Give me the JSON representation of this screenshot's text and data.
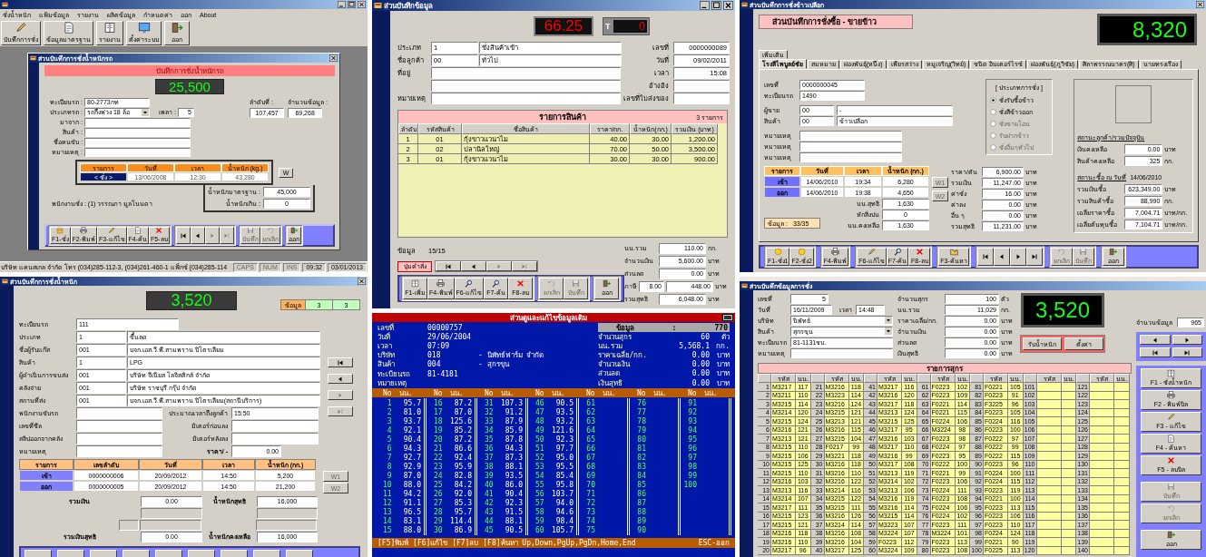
{
  "scale_window": {
    "menu": [
      "ชั่งน้ำหนัก",
      "แฟ้มข้อมูล",
      "รายงาน",
      "ผลิตข้อมูล",
      "กำหนดค่า",
      "ออก",
      "About"
    ],
    "toolbar": [
      "บันทึกการชั่ง",
      "ข้อมูลมาตรฐาน",
      "รายงาน",
      "ตั้งค่าระบบ",
      "ออก"
    ],
    "child_title": "ส่วนบันทึกการชั่งน้ำหนักรถ",
    "header": "บันทึกการชั่งน้ำหนักรถ",
    "display": "25,500",
    "fields": [
      {
        "label": "ทะเบียนรถ :",
        "value": "80-2773กท",
        "kind": "text"
      },
      {
        "label": "ประเภทรถ :",
        "value": "รถกึ่งพ่วง 18 ล้อ",
        "kind": "dropdown"
      },
      {
        "label": "มาจาก :",
        "kind": "text"
      },
      {
        "label": "สินค้า :",
        "kind": "text"
      },
      {
        "label": "ชื่อคนขับ :",
        "kind": "text"
      },
      {
        "label": "หมายเหตุ :",
        "kind": "text"
      }
    ],
    "axle": {
      "label": "เพลา :",
      "value": "5"
    },
    "counters": [
      {
        "label": "ลำดับที่ :",
        "value": "107,457"
      },
      {
        "label": "จำนวนข้อมูล :",
        "value": "69,268"
      }
    ],
    "table": {
      "columns": [
        "รายการ",
        "วันที่",
        "เวลา",
        "น้ำหนัก (kg.)"
      ],
      "row": [
        "< ชั่ง >",
        "13/06/2008",
        "12:30",
        "43,280"
      ]
    },
    "w_button": "W",
    "limits": [
      {
        "label": "น้ำหนักมาตรฐาน :",
        "value": "45,000"
      },
      {
        "label": "น้ำหนักเกิน :",
        "value": "0"
      }
    ],
    "operator": "พนักงานชั่ง : (1) วรรณภา มูลโนนดา",
    "buttons": [
      {
        "label": "F1-ชั่ง",
        "disabled": false
      },
      {
        "label": "F2-พิมพ์",
        "disabled": false
      },
      {
        "label": "F3-แก้ไข",
        "disabled": false
      },
      {
        "label": "F4-ค้น",
        "disabled": false
      },
      {
        "label": "F5-ลบ",
        "disabled": false
      }
    ],
    "nav": [
      {
        "disabled": false
      },
      {
        "disabled": false
      },
      {
        "disabled": true
      },
      {
        "disabled": true
      }
    ],
    "actions": [
      {
        "label": "บันทึก",
        "disabled": true
      },
      {
        "label": "ยกเลิก",
        "disabled": true
      },
      {
        "label": "ออก",
        "disabled": false
      }
    ],
    "status_bar": {
      "company": "บริษัท แคนสเกล จำกัด  โทร (034)285-112-3, (034)261-460-1  แฟ็กซ์ (034)285-114",
      "cells": [
        {
          "text": "CAPS",
          "on": false
        },
        {
          "text": "NUM",
          "on": false
        },
        {
          "text": "INS",
          "on": false
        },
        {
          "text": "09:32",
          "on": true
        },
        {
          "text": "03/01/2013",
          "on": true
        }
      ]
    }
  },
  "invoice_window": {
    "title": "ส่วนบันทึกข้อมูล",
    "display": "66.25",
    "tare": {
      "label": "T",
      "value": "0"
    },
    "left_fields": [
      {
        "label": "ประเภท",
        "code": "1",
        "value": "ชั่งสินค้าเข้า",
        "kind": "coded"
      },
      {
        "label": "ชื่อลูกค้า",
        "code": "00",
        "value": "ทั่วไป",
        "kind": "coded"
      },
      {
        "label": "ที่อยู่",
        "kind": "wide"
      },
      {
        "kind": "wide"
      },
      {
        "label": "หมายเหตุ",
        "kind": "wide"
      }
    ],
    "right_fields": [
      {
        "label": "เลขที่",
        "value": "0000000089"
      },
      {
        "label": "วันที่",
        "value": "09/02/2011"
      },
      {
        "label": "เวลา",
        "value": "15:08"
      },
      {
        "label": "อ้างอิง"
      },
      {
        "label": "เลขที่ใบส่งของ"
      }
    ],
    "table": {
      "title": "รายการสินค้า",
      "count": "3  รายการ",
      "columns": [
        "ลำดับ",
        "รหัสสินค้า",
        "ชื่อสินค้า",
        "ราคา/กก.",
        "น้ำหนัก(กก.)",
        "รวมเงิน (บาท)"
      ],
      "rows": [
        [
          "1",
          "01",
          "กุ้งขาวแวนาไม",
          "40.00",
          "30.00",
          "1,200.00"
        ],
        [
          "2",
          "02",
          "ปลานิลใหญ่",
          "70.00",
          "50.00",
          "3,500.00"
        ],
        [
          "3",
          "01",
          "กุ้งขาวแวนาไม",
          "30.00",
          "30.00",
          "900.00"
        ]
      ]
    },
    "record": {
      "label": "ข้อมูล",
      "value": "15/15"
    },
    "command_button": "ปุ่มคำสั่ง",
    "nav": [
      {
        "disabled": false
      },
      {
        "disabled": false
      },
      {
        "disabled": true
      },
      {
        "disabled": true
      }
    ],
    "buttons": [
      {
        "label": "F1-เพิ่ม",
        "disabled": false
      },
      {
        "label": "F4-พิมพ์",
        "disabled": false
      },
      {
        "label": "F6-แก้ไข",
        "disabled": false
      },
      {
        "label": "F7-ค้น",
        "disabled": false
      },
      {
        "label": "F8-ลบ",
        "disabled": false
      }
    ],
    "actions": [
      {
        "label": "ยกเลิก",
        "disabled": true
      },
      {
        "label": "บันทึก",
        "disabled": true
      },
      {
        "label": "ออก",
        "disabled": false
      }
    ],
    "totals": [
      {
        "label": "นน.รวม",
        "value": "110.00",
        "unit": "กก."
      },
      {
        "label": "จำนวนเงิน",
        "value": "5,600.00",
        "unit": "บาท"
      },
      {
        "label": "ส่วนลด",
        "value": "0.00",
        "unit": "บาท"
      },
      {
        "label": "ภาษี",
        "rate": "8.00",
        "value": "448.00",
        "unit": "บาท"
      },
      {
        "label": "รวมสุทธิ",
        "value": "6,048.00",
        "unit": "บาท"
      }
    ]
  },
  "rice_window": {
    "title": "ส่วนบันทึกการชั่งข้าวเปลือก",
    "header": "ส่วนบันทึกการชั่งซื้อ - ขายข้าว",
    "display": "8,320",
    "tabs_top": [
      {
        "label": "เพิ่มเติม",
        "selected": false
      }
    ],
    "tabs": [
      {
        "label": "โรงสีไพบูลย์ชัย",
        "selected": true
      },
      {
        "label": "สมหมาย",
        "selected": false
      },
      {
        "label": "ผ่องพันธุ์(หนึ่ง)",
        "selected": false
      },
      {
        "label": "เพียรสว่าง",
        "selected": false
      },
      {
        "label": "หมูเจริญ(วิทย์)",
        "selected": false
      },
      {
        "label": "ชนิด อินเตอร์ไรซ์",
        "selected": false
      },
      {
        "label": "ผ่องพันธุ์(ภูวิชัย)",
        "selected": false
      },
      {
        "label": "ศิลาพรรณนาคร(ศิ)",
        "selected": false
      },
      {
        "label": "นายทรงเรือง",
        "selected": false
      }
    ],
    "fields": [
      {
        "label": "เลขที่",
        "value": "0000000045",
        "kind": "single"
      },
      {
        "label": "ทะเบียนรถ",
        "value": "1490",
        "kind": "single"
      },
      {
        "label": "ผู้ขาย",
        "code": "00",
        "value": "-",
        "kind": "coded"
      },
      {
        "label": "สินค้า",
        "code": "00",
        "value": "ข้าวเปลือก",
        "kind": "coded"
      },
      {
        "label": "หมายเหตุ",
        "kind": "note"
      },
      {
        "label": "หมายเหตุ",
        "kind": "note"
      },
      {
        "label": "หมายเหตุ",
        "kind": "note"
      }
    ],
    "type_group": {
      "title": "[ ประเภทการชั่ง ]",
      "options": [
        {
          "label": "ชั่งรับซื้อข้าว",
          "selected": true,
          "disabled": false
        },
        {
          "label": "ชั่งสีข้าวออก",
          "selected": false,
          "disabled": false
        },
        {
          "label": "ชั่งขายโอน",
          "selected": false,
          "disabled": true
        },
        {
          "label": "รับฝากข้าว",
          "selected": false,
          "disabled": true
        },
        {
          "label": "ชั่งอื่นๆทั่วไป",
          "selected": false,
          "disabled": true
        }
      ]
    },
    "table": {
      "columns": [
        "รายการ",
        "วันที่",
        "เวลา",
        "น้ำหนัก (กก.)"
      ],
      "rows": [
        [
          "เข้า",
          "14/06/2010",
          "19:34",
          "6,280"
        ],
        [
          "ออก",
          "14/06/2010",
          "19:38",
          "4,650"
        ]
      ]
    },
    "w_buttons": [
      {
        "label": "W1",
        "disabled": true
      },
      {
        "label": "W2",
        "disabled": true
      }
    ],
    "weights": [
      {
        "label": "นน.สุทธิ",
        "value": "1,630"
      },
      {
        "label": "หักสิ่งปน",
        "value": "0"
      },
      {
        "label": "นน.คงเหลือ",
        "value": "1,630"
      }
    ],
    "record": {
      "label": "ข้อมูล :",
      "value": "33/35"
    },
    "money": [
      {
        "label": "ราคา/ตัน",
        "value": "6,900.00",
        "unit": "บาท"
      },
      {
        "label": "รวมเงิน",
        "value": "11,247.00",
        "unit": "บาท"
      },
      {
        "label": "ค่าชั่ง",
        "value": "16.00",
        "unit": "บาท"
      },
      {
        "label": "ค่าลง",
        "value": "0.00",
        "unit": "บาท"
      },
      {
        "label": "อื่น ๆ",
        "value": "0.00",
        "unit": "บาท"
      },
      {
        "label": "รวมสุทธิ",
        "value": "11,231.00",
        "unit": "บาท"
      }
    ],
    "customer_status": {
      "title": "สถานะลูกค้า/รวมปัจจุบัน",
      "rows": [
        {
          "label": "เงินคงเหลือ",
          "value": "0.00",
          "unit": "บาท"
        },
        {
          "label": "สินค้าคงเหลือ",
          "value": "325",
          "unit": "กก."
        }
      ]
    },
    "purchase_status": {
      "title": "สถานะซื้อ ณ วันที่",
      "date": "14/06/2010",
      "rows": [
        {
          "label": "รวมเงินซื้อ",
          "value": "623,349.00",
          "unit": "บาท"
        },
        {
          "label": "รวมสินค้าซื้อ",
          "value": "88,990",
          "unit": "กก."
        },
        {
          "label": "เฉลี่ยราคาซื้อ",
          "value": "7,004.71",
          "unit": "บาท/กก."
        },
        {
          "label": "เฉลี่ยต้นทุนซื้อ",
          "value": "7,104.71",
          "unit": "บาท/กก."
        }
      ]
    },
    "buttons": [
      {
        "label": "F1-ชั่ง1",
        "disabled": false
      },
      {
        "label": "F2-ชั่ง2",
        "disabled": false
      },
      {
        "label": "F4-พิมพ์",
        "disabled": false
      },
      {
        "label": "F6-แก้ไข",
        "disabled": false
      },
      {
        "label": "F7-ค้น",
        "disabled": false
      },
      {
        "label": "F8-ลบ",
        "disabled": false
      },
      {
        "label": "F3-ค้นหา",
        "disabled": false
      }
    ],
    "nav": [
      {
        "disabled": false
      },
      {
        "disabled": false
      },
      {
        "disabled": false
      },
      {
        "disabled": false
      }
    ],
    "actions": [
      {
        "label": "ยกเลิก",
        "disabled": true
      },
      {
        "label": "บันทึก",
        "disabled": true
      },
      {
        "label": "ออก",
        "disabled": false
      }
    ]
  },
  "gas_window": {
    "title": "ส่วนบันทึกการชั่งน้ำหนัก",
    "display": "3,520",
    "record": {
      "label": "ข้อมูล",
      "values": [
        "3",
        "3"
      ]
    },
    "fields": [
      {
        "label": "ทะเบียนรถ",
        "value": "111",
        "kind": "single"
      },
      {
        "label": "ประเภท",
        "code": "1",
        "value": "ขึ้นลด",
        "kind": "coded"
      },
      {
        "label": "ชื่อผู้รับแก๊ส",
        "code": "001",
        "value": "บจก.เอส.วี.พี.สามพราน ปิโตรเลียม",
        "kind": "coded"
      },
      {
        "label": "สินค้า",
        "code": "1",
        "value": "LPG",
        "kind": "coded"
      },
      {
        "label": "ผู้ดำเนินการขนส่ง",
        "code": "001",
        "value": "บริษัท จีเนียส โลจิสติกส์ จำกัด",
        "kind": "coded"
      },
      {
        "label": "คลังจ่าย",
        "code": "001",
        "value": "บริษัท ราชบุรี กรุ๊ป จำกัด",
        "kind": "coded"
      },
      {
        "label": "สถานที่ส่ง",
        "code": "001",
        "value": "บจก.เอส.วี.พี.สามพราน ปิโตรเลียม(สถานีบริการ)",
        "kind": "coded"
      }
    ],
    "lower_rows": [
      {
        "label": "พนักงานขับรถ",
        "side": {
          "label": "ประมาณเวลาถึงลูกค้า",
          "value": "15:50",
          "kind": "wide"
        }
      },
      {
        "label": "เลขที่ซีล",
        "side": {
          "label": "มิเตอร์ก่อนลง",
          "kind": "wide"
        }
      },
      {
        "label": "สลิปออกจากคลัง",
        "side": {
          "label": "มิเตอร์หลังลง",
          "kind": "wide"
        }
      },
      {
        "label": "หมายเหตุ",
        "side": {
          "label": "ราคา/ -",
          "value": "0.00",
          "kind": "short"
        }
      }
    ],
    "nav": [
      {
        "disabled": false
      },
      {
        "disabled": false
      },
      {
        "disabled": true
      },
      {
        "disabled": true
      }
    ],
    "table": {
      "columns": [
        "รายการ",
        "เลขลำดับ",
        "วันที่",
        "เวลา",
        "น้ำหนัก (กก.)"
      ],
      "rows": [
        [
          "เข้า",
          "0000000006",
          "20/09/2012",
          "14:50",
          "5,200"
        ],
        [
          "ออก",
          "0000000005",
          "20/09/2012",
          "14:50",
          "21,200"
        ]
      ]
    },
    "w_buttons": [
      {
        "label": "W1",
        "disabled": true
      },
      {
        "label": "W2",
        "disabled": true
      }
    ],
    "totals": [
      {
        "label": "รวมเงิน",
        "value": "0.00"
      },
      {
        "label": "น้ำหนักสุทธิ",
        "value": "16,000"
      },
      {
        "label": "รวมเงินสุทธิ",
        "value": "0.00"
      },
      {
        "label": "น้ำหนักคงเหลือ",
        "value": "16,000"
      }
    ]
  },
  "dos_window": {
    "title": "ส่วนดูและแก้ไขข้อมูลเดิม",
    "record": {
      "label": "ข้อมูล",
      "sep": ":",
      "value": "770"
    },
    "left": [
      {
        "label": "เลขที่",
        "value": "00000757"
      },
      {
        "label": "วันที่",
        "value": "29/06/2004"
      },
      {
        "label": "เวลา",
        "value": "07:09"
      },
      {
        "label": "บริษัท",
        "value": "018",
        "name": "-  นิพัทธ์ฟาร์ม จำกัด"
      },
      {
        "label": "สินค้า",
        "value": "004",
        "name": "-  สุกรขุน"
      },
      {
        "label": "ทะเบียนรถ",
        "value": "81-4181"
      },
      {
        "label": "หมายเหตุ"
      }
    ],
    "right": [
      {
        "label": "จำนวนสุกร",
        "value": "60",
        "unit": "ตัว"
      },
      {
        "label": "นน.รวม",
        "value": "5,568.1",
        "unit": "กก."
      },
      {
        "label": "ราคาเฉลี่ย/กก.",
        "value": "0.00",
        "unit": "บาท"
      },
      {
        "label": "จำนวนเงิน",
        "value": "0.00",
        "unit": "บาท"
      },
      {
        "label": "ส่วนลด",
        "value": "0.00",
        "unit": "บาท"
      },
      {
        "label": "เงินสุทธิ",
        "value": "0.00",
        "unit": "บาท"
      }
    ],
    "columns": [
      "No",
      "นน.",
      "No",
      "นน.",
      "No",
      "นน.",
      "No",
      "นน.",
      "No",
      "นน.",
      "No",
      "นน.",
      "No",
      "นน."
    ],
    "rows": [
      [
        "1",
        "95.7",
        "16",
        "87.2",
        "31",
        "107.3",
        "46",
        "90.5",
        "61",
        "",
        "76",
        "",
        "91",
        ""
      ],
      [
        "2",
        "81.0",
        "17",
        "87.0",
        "32",
        "91.2",
        "47",
        "93.5",
        "62",
        "",
        "77",
        "",
        "92",
        ""
      ],
      [
        "3",
        "93.7",
        "18",
        "125.6",
        "33",
        "87.9",
        "48",
        "93.2",
        "63",
        "",
        "78",
        "",
        "93",
        ""
      ],
      [
        "4",
        "92.1",
        "19",
        "85.2",
        "34",
        "85.9",
        "49",
        "121.6",
        "64",
        "",
        "79",
        "",
        "94",
        ""
      ],
      [
        "5",
        "90.4",
        "20",
        "87.2",
        "35",
        "87.8",
        "50",
        "92.3",
        "65",
        "",
        "80",
        "",
        "95",
        ""
      ],
      [
        "6",
        "94.3",
        "21",
        "86.6",
        "36",
        "94.3",
        "51",
        "97.7",
        "66",
        "",
        "81",
        "",
        "96",
        ""
      ],
      [
        "7",
        "92.7",
        "22",
        "92.4",
        "37",
        "87.3",
        "52",
        "95.0",
        "67",
        "",
        "82",
        "",
        "97",
        ""
      ],
      [
        "8",
        "92.9",
        "23",
        "95.9",
        "38",
        "88.1",
        "53",
        "95.5",
        "68",
        "",
        "83",
        "",
        "98",
        ""
      ],
      [
        "9",
        "87.0",
        "24",
        "82.8",
        "39",
        "93.5",
        "54",
        "85.4",
        "69",
        "",
        "84",
        "",
        "99",
        ""
      ],
      [
        "10",
        "88.0",
        "25",
        "84.2",
        "40",
        "86.0",
        "55",
        "95.8",
        "70",
        "",
        "85",
        "",
        "100",
        ""
      ],
      [
        "11",
        "94.2",
        "26",
        "92.0",
        "41",
        "90.4",
        "56",
        "103.7",
        "71",
        "",
        "86",
        "",
        "",
        ""
      ],
      [
        "12",
        "91.1",
        "27",
        "85.3",
        "42",
        "92.3",
        "57",
        "94.0",
        "72",
        "",
        "87",
        "",
        "",
        ""
      ],
      [
        "13",
        "96.5",
        "28",
        "95.7",
        "43",
        "91.5",
        "58",
        "94.6",
        "73",
        "",
        "88",
        "",
        "",
        ""
      ],
      [
        "14",
        "83.1",
        "29",
        "114.4",
        "44",
        "88.1",
        "59",
        "98.4",
        "74",
        "",
        "89",
        "",
        "",
        ""
      ],
      [
        "15",
        "88.0",
        "30",
        "86.9",
        "45",
        "90.5",
        "60",
        "105.7",
        "75",
        "",
        "90",
        "",
        "",
        ""
      ]
    ],
    "footer": "[F5]พิมพ์ [F6]แก้ไข [F7]ลบ [F8]ค้นหา Up,Down,PgUp,PgDn,Home,End",
    "footer_right": "ESC-ออก"
  },
  "pig_window": {
    "title": "ส่วนบันทึกข้อมูลการชั่ง",
    "fields": [
      {
        "label": "เลขที่",
        "value": "5",
        "kind": "number"
      },
      {
        "label": "วันที่",
        "value": "16/11/2009",
        "kind": "date",
        "time_label": "เวลา",
        "time": "14:48"
      },
      {
        "label": "บริษัท",
        "value": "นิพัทธ์",
        "kind": "dropdown"
      },
      {
        "label": "สินค้า",
        "value": "สุกรขุน",
        "kind": "dropdown"
      },
      {
        "label": "ทะเบียนรถ",
        "value": "81-1131ชบ.",
        "kind": "text"
      },
      {
        "label": "หมายเหตุ",
        "kind": "text"
      }
    ],
    "totals": [
      {
        "label": "จำนวนสุกร",
        "value": "100",
        "unit": "ตัว"
      },
      {
        "label": "นน.รวม",
        "value": "11,029",
        "unit": "กก."
      },
      {
        "label": "ราคาเฉลี่ย/กก.",
        "value": "0.00",
        "unit": "บาท"
      },
      {
        "label": "จำนวนเงิน",
        "value": "0.00",
        "unit": "บาท"
      },
      {
        "label": "ส่วนลด",
        "value": "0.00",
        "unit": "บาท"
      },
      {
        "label": "เงินสุทธิ",
        "value": "0.00",
        "unit": "บาท"
      }
    ],
    "display": "3,520",
    "scale_buttons": [
      "รับน้ำหนัก",
      "ตั้งค่า"
    ],
    "count": {
      "label": "จำนวนข้อมูล",
      "value": "965"
    },
    "nav": [
      {
        "disabled": false
      },
      {
        "disabled": false
      },
      {
        "disabled": false
      },
      {
        "disabled": false
      }
    ],
    "table": {
      "title": "รายการสุกร",
      "columns": [
        "",
        "รหัส",
        "นน.",
        "",
        "รหัส",
        "นน.",
        "",
        "รหัส",
        "นน.",
        "",
        "รหัส",
        "นน.",
        "",
        "รหัส",
        "นน.",
        "",
        "รหัส",
        "นน.",
        "",
        "รหัส",
        "นน."
      ],
      "rows": [
        [
          "1",
          "M3217",
          "117",
          "21",
          "M3216",
          "118",
          "41",
          "M3217",
          "116",
          "61",
          "F0223",
          "102",
          "81",
          "F0221",
          "105",
          "101",
          "",
          "",
          "121",
          "",
          ""
        ],
        [
          "2",
          "M3211",
          "110",
          "22",
          "M3223",
          "114",
          "42",
          "M3216",
          "120",
          "62",
          "F0223",
          "109",
          "82",
          "F0223",
          "91",
          "102",
          "",
          "",
          "122",
          "",
          ""
        ],
        [
          "3",
          "M3215",
          "114",
          "23",
          "M3216",
          "124",
          "43",
          "M3217",
          "118",
          "63",
          "F0221",
          "114",
          "83",
          "F3225",
          "96",
          "103",
          "",
          "",
          "123",
          "",
          ""
        ],
        [
          "4",
          "M3214",
          "120",
          "24",
          "M3215",
          "121",
          "44",
          "M3213",
          "124",
          "64",
          "F0221",
          "115",
          "84",
          "F0223",
          "105",
          "104",
          "",
          "",
          "124",
          "",
          ""
        ],
        [
          "5",
          "M3215",
          "124",
          "25",
          "M3213",
          "121",
          "45",
          "M3215",
          "125",
          "65",
          "F0224",
          "106",
          "85",
          "F0224",
          "116",
          "105",
          "",
          "",
          "125",
          "",
          ""
        ],
        [
          "6",
          "M3216",
          "121",
          "26",
          "M3216",
          "115",
          "46",
          "M3217",
          "95",
          "66",
          "M3224",
          "98",
          "86",
          "F0223",
          "100",
          "106",
          "",
          "",
          "126",
          "",
          ""
        ],
        [
          "7",
          "M3213",
          "121",
          "27",
          "M3215",
          "104",
          "47",
          "M3216",
          "103",
          "67",
          "F0223",
          "98",
          "87",
          "F0222",
          "97",
          "107",
          "",
          "",
          "127",
          "",
          ""
        ],
        [
          "8",
          "M3215",
          "110",
          "28",
          "F0217",
          "99",
          "48",
          "M3217",
          "110",
          "68",
          "F0224",
          "97",
          "88",
          "F0222",
          "99",
          "108",
          "",
          "",
          "128",
          "",
          ""
        ],
        [
          "9",
          "M3215",
          "106",
          "29",
          "M3221",
          "118",
          "49",
          "M3216",
          "99",
          "69",
          "F0223",
          "95",
          "89",
          "F0222",
          "115",
          "109",
          "",
          "",
          "129",
          "",
          ""
        ],
        [
          "10",
          "M3215",
          "125",
          "30",
          "M3216",
          "118",
          "50",
          "M3217",
          "108",
          "70",
          "F0222",
          "100",
          "90",
          "F0223",
          "96",
          "110",
          "",
          "",
          "130",
          "",
          ""
        ],
        [
          "11",
          "M3215",
          "110",
          "31",
          "M3216",
          "110",
          "51",
          "M3213",
          "119",
          "71",
          "F0221",
          "99",
          "91",
          "F0224",
          "100",
          "111",
          "",
          "",
          "131",
          "",
          ""
        ],
        [
          "12",
          "M3216",
          "103",
          "32",
          "M3216",
          "122",
          "52",
          "M3214",
          "102",
          "72",
          "F0223",
          "106",
          "92",
          "F0224",
          "115",
          "112",
          "",
          "",
          "132",
          "",
          ""
        ],
        [
          "13",
          "M3213",
          "116",
          "33",
          "M3214",
          "116",
          "53",
          "M3213",
          "106",
          "73",
          "F0224",
          "111",
          "93",
          "F0223",
          "119",
          "113",
          "",
          "",
          "133",
          "",
          ""
        ],
        [
          "14",
          "M3214",
          "107",
          "34",
          "M3215",
          "122",
          "54",
          "M3216",
          "119",
          "74",
          "F0223",
          "108",
          "94",
          "F0221",
          "100",
          "114",
          "",
          "",
          "134",
          "",
          ""
        ],
        [
          "15",
          "M3217",
          "111",
          "35",
          "M3215",
          "111",
          "55",
          "M3216",
          "114",
          "75",
          "F0224",
          "106",
          "95",
          "F0223",
          "113",
          "115",
          "",
          "",
          "135",
          "",
          ""
        ],
        [
          "16",
          "M3215",
          "123",
          "36",
          "M3216",
          "126",
          "56",
          "M3215",
          "114",
          "76",
          "F0224",
          "102",
          "96",
          "F0223",
          "106",
          "116",
          "",
          "",
          "136",
          "",
          ""
        ],
        [
          "17",
          "M3215",
          "121",
          "37",
          "M3214",
          "114",
          "57",
          "M3223",
          "107",
          "77",
          "F0223",
          "111",
          "97",
          "F0223",
          "110",
          "117",
          "",
          "",
          "137",
          "",
          ""
        ],
        [
          "18",
          "M3216",
          "118",
          "38",
          "M3216",
          "108",
          "58",
          "M3224",
          "107",
          "78",
          "M3224",
          "101",
          "98",
          "F0224",
          "124",
          "118",
          "",
          "",
          "138",
          "",
          ""
        ],
        [
          "19",
          "M3216",
          "110",
          "39",
          "M3216",
          "104",
          "59",
          "F0223",
          "112",
          "79",
          "F0223",
          "113",
          "99",
          "F0221",
          "90",
          "119",
          "",
          "",
          "139",
          "",
          ""
        ],
        [
          "20",
          "M3217",
          "96",
          "40",
          "M3217",
          "125",
          "60",
          "M3224",
          "109",
          "80",
          "F0223",
          "108",
          "100",
          "F0225",
          "113",
          "120",
          "",
          "",
          "140",
          "",
          ""
        ]
      ]
    },
    "buttons": [
      {
        "label": "F1 - ชั่งน้ำหนัก",
        "disabled": false
      },
      {
        "label": "F2 - พิมพ์บิล",
        "disabled": false
      },
      {
        "label": "F3 - แก้ไข",
        "disabled": false
      },
      {
        "label": "F4 - ค้นหา",
        "disabled": false
      },
      {
        "label": "F5 - ลบบิล",
        "disabled": false
      },
      {
        "label": "บันทึก",
        "disabled": true
      },
      {
        "label": "ยกเลิก",
        "disabled": true
      },
      {
        "label": "ออก",
        "disabled": false
      }
    ]
  }
}
